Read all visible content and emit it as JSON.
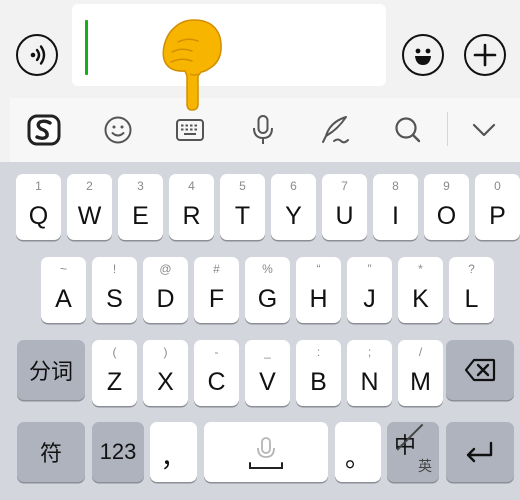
{
  "keyboard": {
    "row1": [
      {
        "hint": "1",
        "key": "Q"
      },
      {
        "hint": "2",
        "key": "W"
      },
      {
        "hint": "3",
        "key": "E"
      },
      {
        "hint": "4",
        "key": "R"
      },
      {
        "hint": "5",
        "key": "T"
      },
      {
        "hint": "6",
        "key": "Y"
      },
      {
        "hint": "7",
        "key": "U"
      },
      {
        "hint": "8",
        "key": "I"
      },
      {
        "hint": "9",
        "key": "O"
      },
      {
        "hint": "0",
        "key": "P"
      }
    ],
    "row2": [
      {
        "hint": "~",
        "key": "A"
      },
      {
        "hint": "!",
        "key": "S"
      },
      {
        "hint": "@",
        "key": "D"
      },
      {
        "hint": "#",
        "key": "F"
      },
      {
        "hint": "%",
        "key": "G"
      },
      {
        "hint": "“",
        "key": "H"
      },
      {
        "hint": "”",
        "key": "J"
      },
      {
        "hint": "*",
        "key": "K"
      },
      {
        "hint": "?",
        "key": "L"
      }
    ],
    "row3": [
      {
        "hint": "(",
        "key": "Z"
      },
      {
        "hint": ")",
        "key": "X"
      },
      {
        "hint": "-",
        "key": "C"
      },
      {
        "hint": "_",
        "key": "V"
      },
      {
        "hint": ":",
        "key": "B"
      },
      {
        "hint": ";",
        "key": "N"
      },
      {
        "hint": "/",
        "key": "M"
      }
    ],
    "segment_label": "分词",
    "symbol_label": "符",
    "numbers_label": "123",
    "comma_label": "，",
    "period_label": "。",
    "lang_main": "中",
    "lang_alt": "英"
  },
  "icons": {
    "voice": "voice-message-icon",
    "emoji": "emoji-icon",
    "plus": "add-icon",
    "ime_logo": "sogou-logo-icon",
    "smiley": "smiley-tool-icon",
    "keyboard": "keyboard-icon",
    "mic": "microphone-icon",
    "handwriting": "handwriting-icon",
    "search": "search-icon",
    "collapse": "chevron-down-icon",
    "backspace": "backspace-icon",
    "enter": "enter-icon",
    "pointing_hand": "pointing-hand-icon"
  },
  "colors": {
    "caret": "#1aad19",
    "hand": "#f7b500"
  }
}
